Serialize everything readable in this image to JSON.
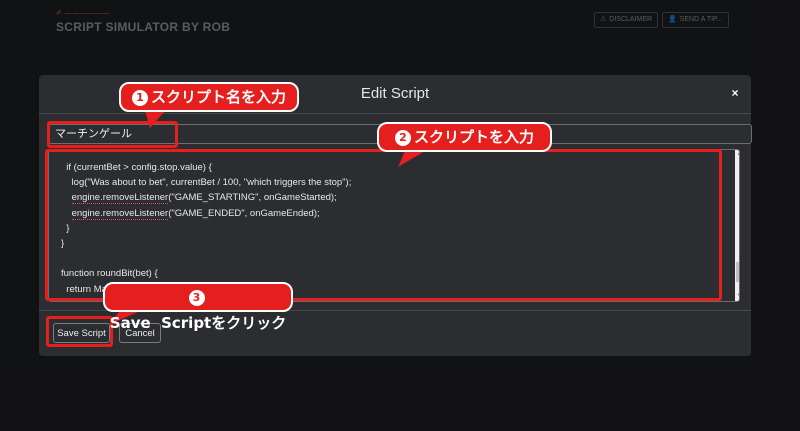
{
  "app": {
    "brand_small": "✐ ——————",
    "title": "SCRIPT SIMULATOR BY ROB",
    "disclaimer_label": "DISCLAIMER",
    "tip_label": "SEND A TIP..."
  },
  "modal": {
    "title": "Edit Script",
    "close_glyph": "×",
    "name_value": "マーチンゲール",
    "code_lines": [
      "  if (currentBet > config.stop.value) {",
      "    log(\"Was about to bet\", currentBet / 100, \"which triggers the stop\");",
      "    engine.removeListener(\"GAME_STARTING\", onGameStarted);",
      "    engine.removeListener(\"GAME_ENDED\", onGameEnded);",
      "  }",
      "}",
      "",
      "function roundBit(bet) {",
      "  return Math.round(bet / 100) * 100;",
      "}"
    ],
    "save_label": "Save Script",
    "cancel_label": "Cancel"
  },
  "annotations": {
    "step1": {
      "num": "1",
      "text": "スクリプト名を入力"
    },
    "step2": {
      "num": "2",
      "text": "スクリプトを入力"
    },
    "step3": {
      "num": "3",
      "text": "Save  Scriptをクリック"
    }
  },
  "colors": {
    "annotation_red": "#e51e1e",
    "modal_bg": "#2b2d31",
    "page_bg": "#1b1c1f"
  },
  "icons": {
    "disclaimer": "warning-icon",
    "tip": "user-icon",
    "close": "close-icon"
  }
}
